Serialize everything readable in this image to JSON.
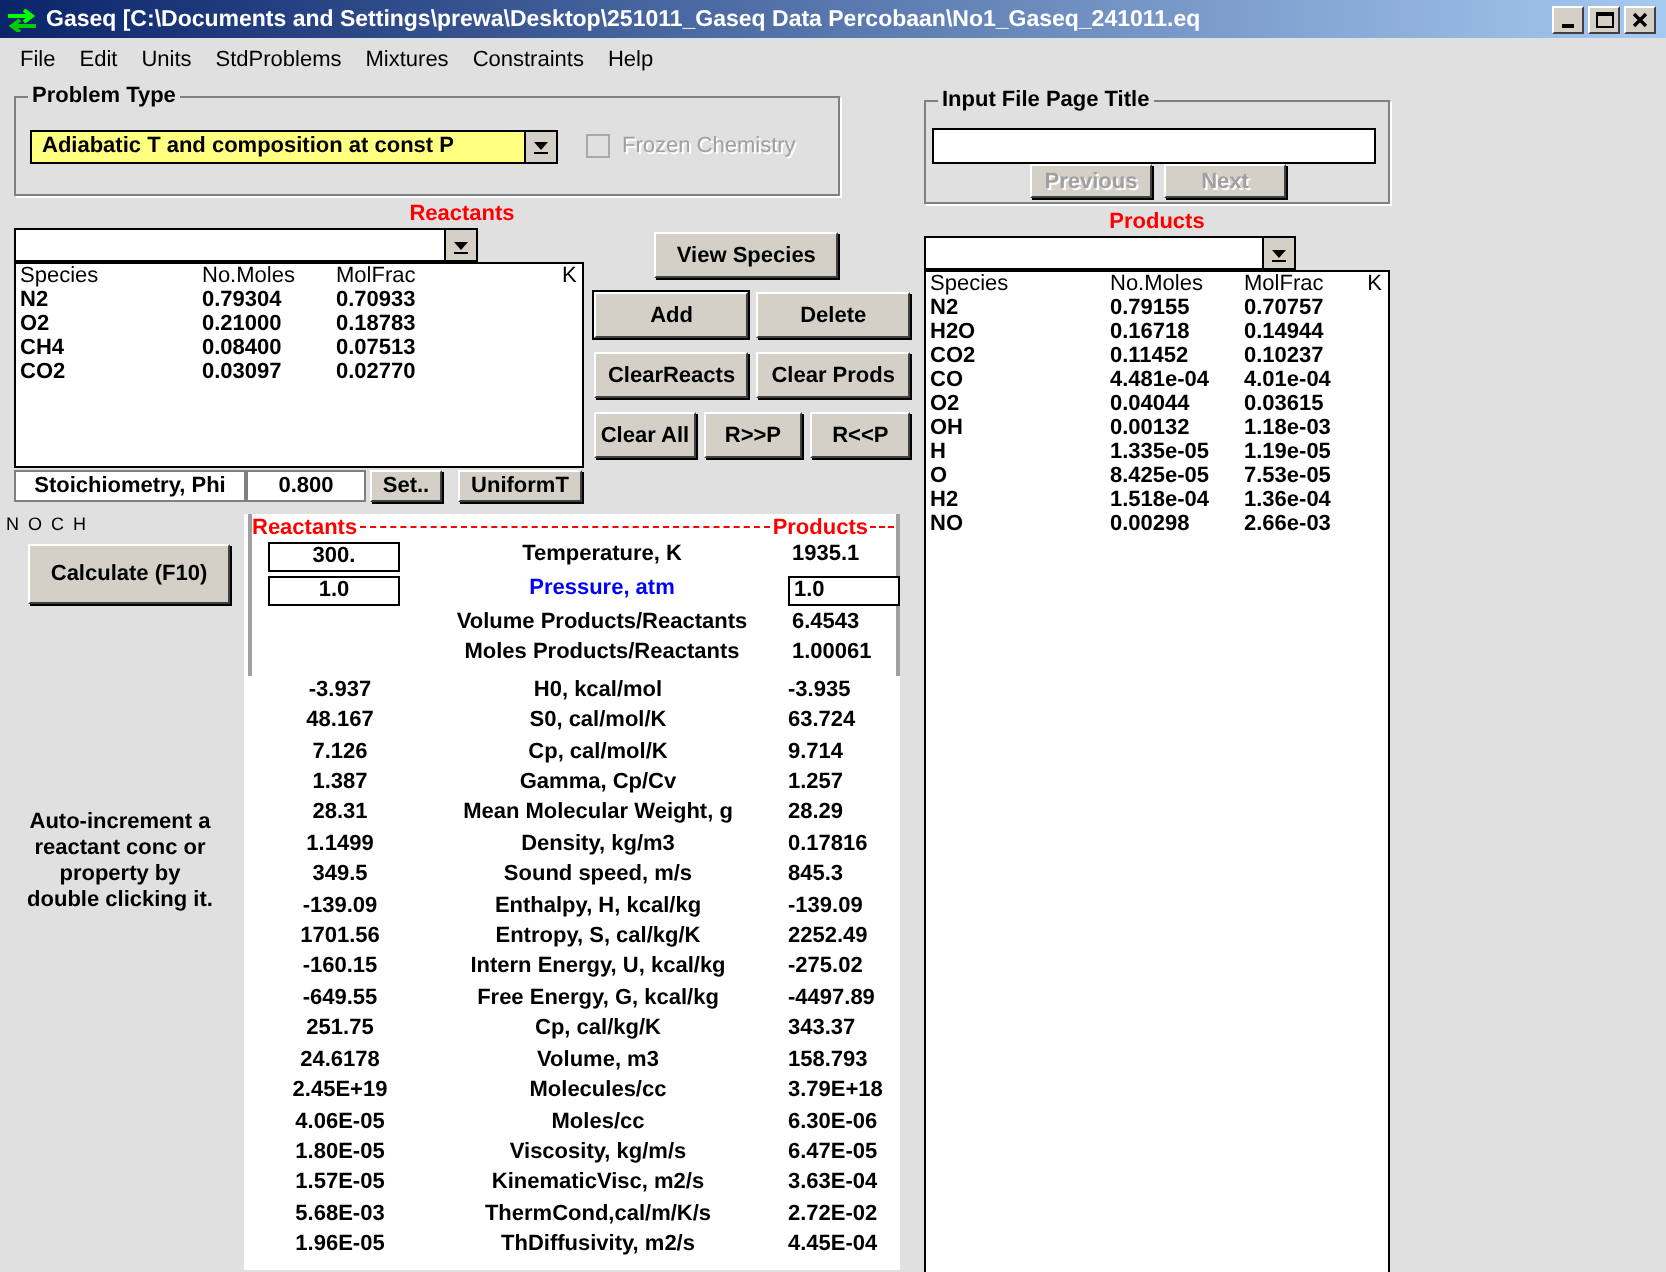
{
  "window": {
    "title": "Gaseq [C:\\Documents and Settings\\prewa\\Desktop\\251011_Gaseq Data Percobaan\\No1_Gaseq_241011.eq"
  },
  "menu": [
    "File",
    "Edit",
    "Units",
    "StdProblems",
    "Mixtures",
    "Constraints",
    "Help"
  ],
  "problem_type": {
    "label": "Problem Type",
    "value": "Adiabatic T and composition at const P",
    "frozen_chemistry": {
      "label": "Frozen Chemistry",
      "checked": false,
      "disabled": true
    }
  },
  "input_file": {
    "label": "Input File Page Title",
    "buttons": [
      {
        "label": "Previous",
        "disabled": true
      },
      {
        "label": "Next",
        "disabled": true
      }
    ]
  },
  "reactants": {
    "title": "Reactants",
    "columns": [
      "Species",
      "No.Moles",
      "MolFrac",
      "K"
    ],
    "rows": [
      [
        "N2",
        "0.79304",
        "0.70933"
      ],
      [
        "O2",
        "0.21000",
        "0.18783"
      ],
      [
        "CH4",
        "0.08400",
        "0.07513"
      ],
      [
        "CO2",
        "0.03097",
        "0.02770"
      ]
    ]
  },
  "action_buttons": [
    [
      {
        "label": "View Species",
        "default": false
      }
    ],
    [
      {
        "label": "Add",
        "default": true
      },
      {
        "label": "Delete",
        "default": false
      }
    ],
    [
      {
        "label": "ClearReacts",
        "default": false
      },
      {
        "label": "Clear Prods",
        "default": false
      }
    ],
    [
      {
        "label": "Clear All",
        "default": false
      },
      {
        "label": "R>>P",
        "default": false
      },
      {
        "label": "R<<P",
        "default": false
      }
    ]
  ],
  "stoichiometry": {
    "label": "Stoichiometry, Phi",
    "value": "0.800",
    "buttons": [
      "Set..",
      "UniformT"
    ]
  },
  "element_order": "N O C H",
  "calculate_button": "Calculate (F10)",
  "hint": "Auto-increment a reactant conc or property by double clicking it.",
  "results": {
    "reactants_heading": "Reactants",
    "products_heading": "Products",
    "state_rows": [
      {
        "reactant": "300.",
        "reactant_editable": true,
        "label": "Temperature, K",
        "label_highlighted": false,
        "product": "1935.1",
        "product_editable": false
      },
      {
        "reactant": "1.0",
        "reactant_editable": true,
        "label": "Pressure, atm",
        "label_highlighted": true,
        "product": "1.0",
        "product_editable": true
      },
      {
        "label": "Volume Products/Reactants",
        "label_highlighted": false,
        "product": "6.4543",
        "product_editable": false
      },
      {
        "label": "Moles Products/Reactants",
        "label_highlighted": false,
        "product": "1.00061",
        "product_editable": false
      }
    ],
    "property_rows": [
      [
        "-3.937",
        "H0,  kcal/mol",
        "-3.935"
      ],
      [
        "48.167",
        "S0,  cal/mol/K",
        "63.724"
      ],
      [
        "7.126",
        "Cp,  cal/mol/K",
        "9.714"
      ],
      [
        "1.387",
        "Gamma, Cp/Cv",
        "1.257"
      ],
      [
        "28.31",
        "Mean Molecular Weight, g",
        "28.29"
      ],
      [
        "1.1499",
        "Density,  kg/m3",
        "0.17816"
      ],
      [
        "349.5",
        "Sound speed,  m/s",
        "845.3"
      ],
      [
        "-139.09",
        "Enthalpy, H,  kcal/kg",
        "-139.09"
      ],
      [
        "1701.56",
        "Entropy,  S,  cal/kg/K",
        "2252.49"
      ],
      [
        "-160.15",
        "Intern Energy, U,  kcal/kg",
        "-275.02"
      ],
      [
        "-649.55",
        "Free Energy, G, kcal/kg",
        "-4497.89"
      ],
      [
        "251.75",
        "Cp, cal/kg/K",
        "343.37"
      ],
      [
        "24.6178",
        "Volume,  m3",
        "158.793"
      ],
      [
        "2.45E+19",
        "Molecules/cc",
        "3.79E+18"
      ],
      [
        "4.06E-05",
        "Moles/cc",
        "6.30E-06"
      ],
      [
        "1.80E-05",
        "Viscosity,  kg/m/s",
        "6.47E-05"
      ],
      [
        "1.57E-05",
        "KinematicVisc,  m2/s",
        "3.63E-04"
      ],
      [
        "5.68E-03",
        "ThermCond,cal/m/K/s",
        "2.72E-02"
      ],
      [
        "1.96E-05",
        "ThDiffusivity,  m2/s",
        "4.45E-04"
      ]
    ]
  },
  "products": {
    "title": "Products",
    "columns": [
      "Species",
      "No.Moles",
      "MolFrac",
      "K"
    ],
    "rows": [
      [
        "N2",
        "0.79155",
        "0.70757"
      ],
      [
        "H2O",
        "0.16718",
        "0.14944"
      ],
      [
        "CO2",
        "0.11452",
        "0.10237"
      ],
      [
        "CO",
        "4.481e-04",
        "4.01e-04"
      ],
      [
        "O2",
        "0.04044",
        "0.03615"
      ],
      [
        "OH",
        "0.00132",
        "1.18e-03"
      ],
      [
        "H",
        "1.335e-05",
        "1.19e-05"
      ],
      [
        "O",
        "8.425e-05",
        "7.53e-05"
      ],
      [
        "H2",
        "1.518e-04",
        "1.36e-04"
      ],
      [
        "NO",
        "0.00298",
        "2.66e-03"
      ]
    ]
  }
}
